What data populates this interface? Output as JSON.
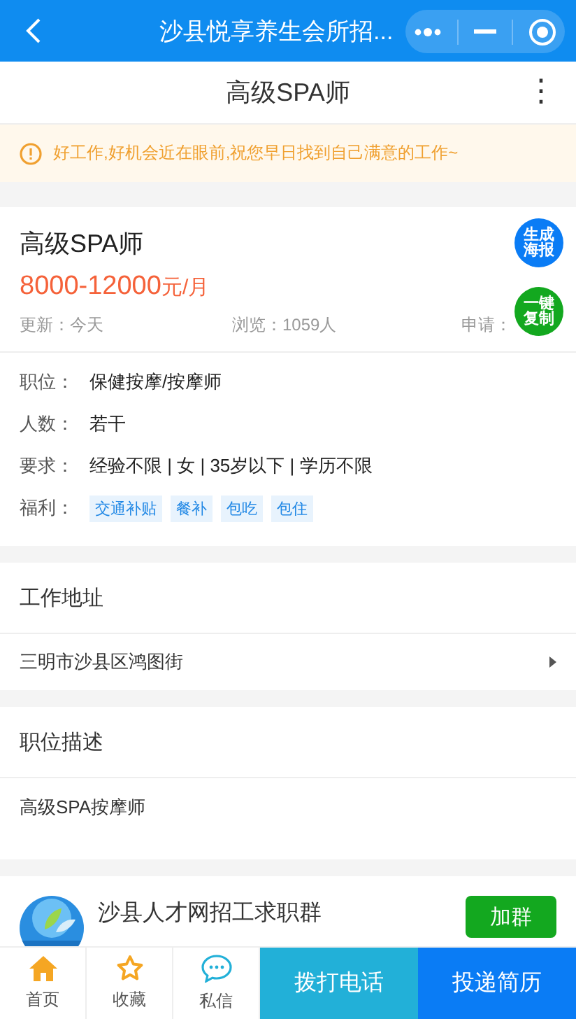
{
  "top_bar": {
    "title": "沙县悦享养生会所招..."
  },
  "title_bar": {
    "title": "高级SPA师",
    "menu_icon": "⋮"
  },
  "notice": {
    "text": "好工作,好机会近在眼前,祝您早日找到自己满意的工作~"
  },
  "job": {
    "title": "高级SPA师",
    "salary": "8000-12000",
    "salary_unit": "元/月",
    "updated": "更新：今天",
    "views": "浏览：1059人",
    "applied": "申请：",
    "float_buttons": [
      {
        "label": "生成海报",
        "color": "#0a7cf5"
      },
      {
        "label": "一键复制",
        "color": "#13a81f"
      }
    ]
  },
  "details": [
    {
      "kind": "text",
      "label": "职位：",
      "value": "保健按摩/按摩师"
    },
    {
      "kind": "text",
      "label": "人数：",
      "value": "若干"
    },
    {
      "kind": "text",
      "label": "要求：",
      "value": "经验不限 | 女 | 35岁以下 | 学历不限"
    },
    {
      "kind": "tags",
      "label": "福利：",
      "tags": [
        "交通补贴",
        "餐补",
        "包吃",
        "包住"
      ]
    }
  ],
  "address": {
    "heading": "工作地址",
    "value": "三明市沙县区鸿图街"
  },
  "description": {
    "heading": "职位描述",
    "text": "高级SPA按摩师"
  },
  "group": {
    "name": "沙县人才网招工求职群",
    "button": "加群"
  },
  "bottom_bar": {
    "tabs": [
      {
        "label": "首页"
      },
      {
        "label": "收藏"
      },
      {
        "label": "私信"
      }
    ],
    "actions": [
      {
        "label": "拨打电话",
        "color": "#22b0d8"
      },
      {
        "label": "投递简历",
        "color": "#0a7cf5"
      }
    ]
  }
}
